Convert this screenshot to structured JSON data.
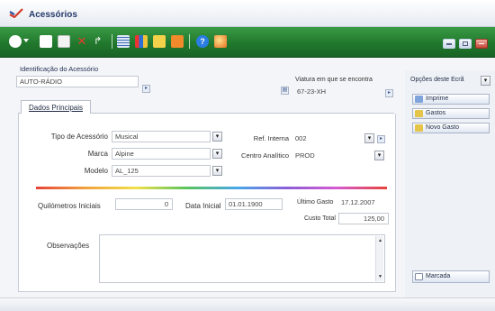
{
  "window": {
    "title": "Acessórios"
  },
  "toolbar": {
    "icons": [
      "new-icon",
      "dropdown-arrow-icon",
      "document-icon",
      "copy-icon",
      "delete-icon",
      "edit-icon",
      "list-icon",
      "chart-icon",
      "filter-icon",
      "export-icon",
      "help-icon",
      "globe-icon"
    ]
  },
  "identification": {
    "label": "Identificação do Acessório",
    "value": "AUTO-RÁDIO"
  },
  "vehicle": {
    "label": "Viatura em que se encontra",
    "value": "67-23-XH"
  },
  "tabs": [
    {
      "label": "Dados Principais",
      "active": true
    }
  ],
  "form": {
    "tipo_label": "Tipo de Acessório",
    "tipo_value": "Musical",
    "marca_label": "Marca",
    "marca_value": "Alpine",
    "modelo_label": "Modelo",
    "modelo_value": "AL_125",
    "ref_label": "Ref. Interna",
    "ref_value": "002",
    "centro_label": "Centro Analítico",
    "centro_value": "PROD",
    "km_label": "Quilómetros Iniciais",
    "km_value": "0",
    "data_label": "Data Inicial",
    "data_value": "01.01.1900",
    "ultimo_gasto_label": "Último Gasto",
    "ultimo_gasto_value": "17.12.2007",
    "custo_label": "Custo Total",
    "custo_value": "125,00",
    "obs_label": "Observações"
  },
  "side": {
    "header": "Opções deste Ecrã",
    "buttons": [
      "Imprime",
      "Gastos",
      "Novo Gasto"
    ],
    "marcada": "Marcada"
  },
  "colors": {
    "toolbar": "#21782d",
    "title": "#243a6a"
  }
}
